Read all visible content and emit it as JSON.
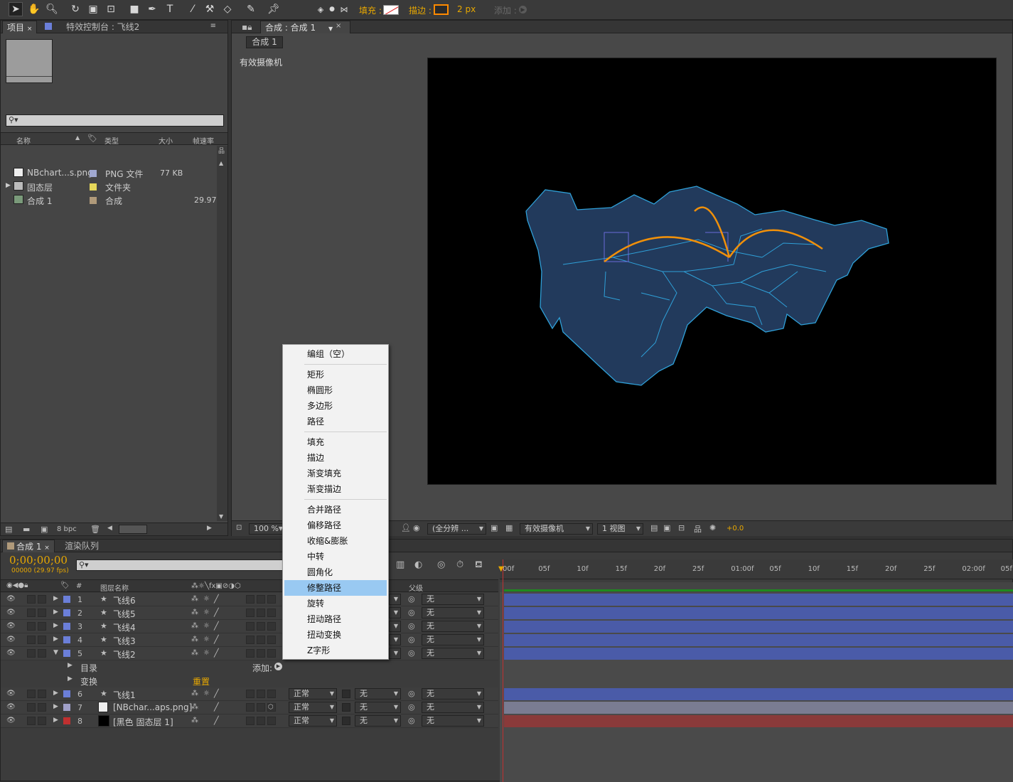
{
  "toolbar": {
    "fill_label": "填充 :",
    "stroke_label": "描边 :",
    "stroke_width": "2 px",
    "add_label": "添加 :"
  },
  "project_panel": {
    "tab_project": "项目",
    "tab_effects": "特效控制台 : 飞线2",
    "search_placeholder": "",
    "columns": {
      "name": "名称",
      "type": "类型",
      "size": "大小",
      "fps": "帧速率"
    },
    "items": [
      {
        "name": "NBchart...s.png",
        "type": "PNG 文件",
        "size": "77 KB",
        "fps": "",
        "color": "#a0a8d0"
      },
      {
        "name": "固态层",
        "type": "文件夹",
        "size": "",
        "fps": "",
        "color": "#e6d85a"
      },
      {
        "name": "合成 1",
        "type": "合成",
        "size": "",
        "fps": "29.97",
        "color": "#b09a7a"
      }
    ],
    "bpc": "8 bpc"
  },
  "comp_panel": {
    "tab": "合成 : 合成 1",
    "subtab": "合成 1",
    "camera_label": "有效摄像机",
    "zoom": "100 %",
    "resolution": "(全分辨 ...",
    "camera_select": "有效摄像机",
    "view_select": "1 视图",
    "exposure": "+0.0"
  },
  "context_menu": {
    "items": [
      {
        "label": "编组（空）",
        "sep": false
      },
      {
        "label": "矩形",
        "sep": true
      },
      {
        "label": "椭圆形",
        "sep": false
      },
      {
        "label": "多边形",
        "sep": false
      },
      {
        "label": "路径",
        "sep": false
      },
      {
        "label": "填充",
        "sep": true
      },
      {
        "label": "描边",
        "sep": false
      },
      {
        "label": "渐变填充",
        "sep": false
      },
      {
        "label": "渐变描边",
        "sep": false
      },
      {
        "label": "合并路径",
        "sep": true
      },
      {
        "label": "偏移路径",
        "sep": false
      },
      {
        "label": "收缩&膨胀",
        "sep": false
      },
      {
        "label": "中转",
        "sep": false
      },
      {
        "label": "圆角化",
        "sep": false
      },
      {
        "label": "修整路径",
        "sep": false,
        "highlighted": true
      },
      {
        "label": "旋转",
        "sep": false
      },
      {
        "label": "扭动路径",
        "sep": false
      },
      {
        "label": "扭动变换",
        "sep": false
      },
      {
        "label": "Z字形",
        "sep": false
      }
    ]
  },
  "timeline": {
    "tab_comp": "合成 1",
    "tab_render": "渲染队列",
    "timecode": "0;00;00;00",
    "fps_info": "00000 (29.97 fps)",
    "col_layer_name": "图层名称",
    "col_parent": "父级",
    "add_label": "添加:",
    "contents_label": "目录",
    "transform_label": "变换",
    "reset_label": "重置",
    "ruler": [
      "00f",
      "05f",
      "10f",
      "15f",
      "20f",
      "25f",
      "01:00f",
      "05f",
      "10f",
      "15f",
      "20f",
      "25f",
      "02:00f",
      "05f"
    ],
    "layers": [
      {
        "num": "1",
        "name": "飞线6",
        "color": "#6b7fd9",
        "mode": "",
        "trk": "",
        "parent": "无",
        "bar": "#4a5ba8"
      },
      {
        "num": "2",
        "name": "飞线5",
        "color": "#6b7fd9",
        "mode": "",
        "trk": "",
        "parent": "无",
        "bar": "#4a5ba8"
      },
      {
        "num": "3",
        "name": "飞线4",
        "color": "#6b7fd9",
        "mode": "",
        "trk": "",
        "parent": "无",
        "bar": "#4a5ba8"
      },
      {
        "num": "4",
        "name": "飞线3",
        "color": "#6b7fd9",
        "mode": "",
        "trk": "",
        "parent": "无",
        "bar": "#4a5ba8"
      },
      {
        "num": "5",
        "name": "飞线2",
        "color": "#6b7fd9",
        "mode": "",
        "trk": "",
        "parent": "无",
        "bar": "#4a5ba8"
      },
      {
        "num": "6",
        "name": "飞线1",
        "color": "#6b7fd9",
        "mode": "正常",
        "trk": "无",
        "parent": "无",
        "bar": "#4a5ba8"
      },
      {
        "num": "7",
        "name": "[NBchar...aps.png]",
        "color": "#a0a0c8",
        "mode": "正常",
        "trk": "无",
        "parent": "无",
        "bar": "#7a7c92"
      },
      {
        "num": "8",
        "name": "[黑色 固态层 1]",
        "color": "#c03030",
        "mode": "正常",
        "trk": "无",
        "parent": "无",
        "bar": "#8a3a3a"
      }
    ]
  }
}
